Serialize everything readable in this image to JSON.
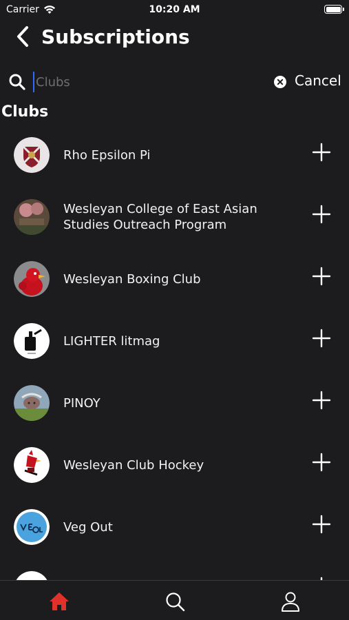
{
  "status_bar": {
    "carrier": "Carrier",
    "time": "10:20 AM"
  },
  "header": {
    "title": "Subscriptions"
  },
  "search": {
    "placeholder": "Clubs",
    "value": "",
    "cancel_label": "Cancel"
  },
  "section": {
    "title": "Clubs"
  },
  "clubs": [
    {
      "name": "Rho Epsilon Pi"
    },
    {
      "name": "Wesleyan College of East Asian Studies Outreach Program"
    },
    {
      "name": "Wesleyan Boxing Club"
    },
    {
      "name": "LIGHTER litmag"
    },
    {
      "name": "PINOY"
    },
    {
      "name": "Wesleyan Club Hockey"
    },
    {
      "name": "Veg Out"
    }
  ],
  "tabs": [
    {
      "id": "home",
      "icon": "home-icon",
      "active": true
    },
    {
      "id": "search",
      "icon": "search-icon",
      "active": false
    },
    {
      "id": "profile",
      "icon": "profile-icon",
      "active": false
    }
  ],
  "colors": {
    "background": "#1c1c1e",
    "accent": "#e0312b",
    "cursor": "#2f6bff"
  }
}
